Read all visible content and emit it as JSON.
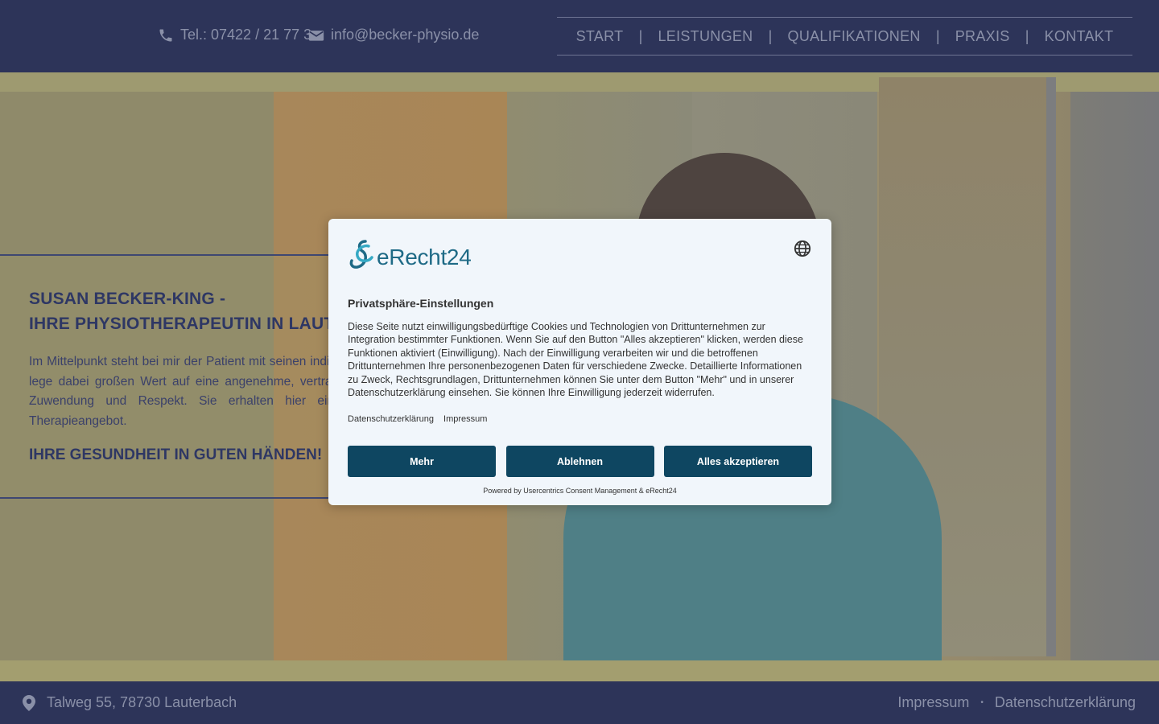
{
  "header": {
    "phone": "Tel.: 07422 / 21 77 3",
    "email": "info@becker-physio.de",
    "nav": [
      {
        "label": "START"
      },
      {
        "label": "LEISTUNGEN"
      },
      {
        "label": "QUALIFIKATIONEN"
      },
      {
        "label": "PRAXIS"
      },
      {
        "label": "KONTAKT"
      }
    ],
    "nav_separator": "|"
  },
  "hero": {
    "heading_line1": "SUSAN BECKER-KING -",
    "heading_line2": "IHRE PHYSIOTHERAPEUTIN IN LAUTERBACH",
    "paragraph": "Im Mittelpunkt steht bei mir der Patient mit seinen individuellen Bedürfnissen. Ich lege dabei großen Wert auf eine angenehme, vertrauensvolle Atmosphäre mit Zuwendung und Respekt. Sie erhalten hier einen Überblick über das Therapieangebot.",
    "tagline": "IHRE GESUNDHEIT IN GUTEN HÄNDEN!"
  },
  "footer": {
    "address": "Talweg 55, 78730 Lauterbach",
    "impressum": "Impressum",
    "datenschutz": "Datenschutzerklärung",
    "separator": "•"
  },
  "consent": {
    "brand": "eRecht24",
    "title": "Privatsphäre-Einstellungen",
    "text": "Diese Seite nutzt einwilligungsbedürftige Cookies und Technologien von Drittunternehmen zur Integration bestimmter Funktionen. Wenn Sie auf den Button \"Alles akzeptieren\" klicken, werden diese Funktionen aktiviert (Einwilligung). Nach der Einwilligung verarbeiten wir und die betroffenen Drittunternehmen Ihre personenbezogenen Daten für verschiedene Zwecke. Detaillierte Informationen zu Zweck, Rechtsgrundlagen, Drittunternehmen können Sie unter dem Button \"Mehr\" und in unserer Datenschutzerklärung einsehen. Sie können Ihre Einwilligung jederzeit widerrufen.",
    "link_privacy": "Datenschutzerklärung",
    "link_imprint": "Impressum",
    "btn_more": "Mehr",
    "btn_decline": "Ablehnen",
    "btn_accept_all": "Alles akzeptieren",
    "powered_by": "Powered by Usercentrics Consent Management & eRecht24"
  },
  "colors": {
    "header_bg": "#2d3459",
    "nav_text": "#8a90a8",
    "heading_blue": "#2e3764",
    "button_bg": "#0e4661",
    "brand_teal": "#1e6a86"
  },
  "icons": [
    "phone-icon",
    "envelope-icon",
    "map-pin-icon",
    "globe-icon",
    "erecht24-logo-icon"
  ]
}
